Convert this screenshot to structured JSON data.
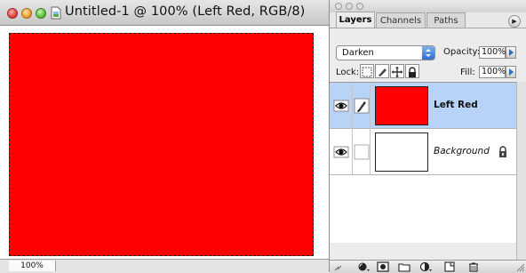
{
  "document": {
    "title": "Untitled-1 @ 100% (Left Red, RGB/8)",
    "canvas_color": "#ff0000",
    "zoom": "100%"
  },
  "layers_panel": {
    "tabs": [
      "Layers",
      "Channels",
      "Paths"
    ],
    "active_tab": "Layers",
    "blend_mode": "Darken",
    "opacity_label": "Opacity:",
    "opacity_value": "100%",
    "lock_label": "Lock:",
    "fill_label": "Fill:",
    "fill_value": "100%",
    "layers": [
      {
        "name": "Left Red",
        "thumbnail_color": "#ff0000",
        "selected": true,
        "visible": true,
        "locked": false
      },
      {
        "name": "Background",
        "thumbnail_color": "#ffffff",
        "selected": false,
        "visible": true,
        "locked": true
      }
    ],
    "footer_icons": [
      "link-icon",
      "layer-style-icon",
      "layer-mask-icon",
      "new-group-icon",
      "adjustment-layer-icon",
      "new-layer-icon",
      "trash-icon"
    ]
  },
  "colors": {
    "selection_highlight": "#b7d3f7",
    "accent_blue": "#2a6fd0"
  }
}
